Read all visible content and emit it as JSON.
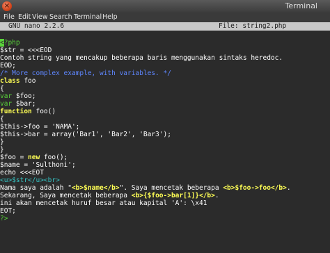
{
  "window": {
    "title": "Terminal",
    "close_glyph": "×"
  },
  "menu": [
    "File",
    "Edit",
    "View",
    "Search",
    "Terminal",
    "Help"
  ],
  "nano": {
    "version": "GNU nano 2.2.6",
    "file": "File: string2.php"
  },
  "code": {
    "l1_open": "<",
    "l1_rest": "?php",
    "l2": "$str = <<<EOD",
    "l3": "Contoh string yang mencakup beberapa baris menggunakan sintaks heredoc.",
    "l4": "EOD;",
    "l5": "/* More complex example, with variables. */",
    "l6_kw": "class",
    "l6_name": " foo",
    "l7": "{",
    "l8_kw": "var",
    "l8_rest": " $foo;",
    "l9_kw": "var",
    "l9_rest": " $bar;",
    "l10_kw": "function",
    "l10_rest": " foo()",
    "l11": "{",
    "l12": "$this->foo = 'NAMA';",
    "l13": "$this->bar = array('Bar1', 'Bar2', 'Bar3');",
    "l14": "}",
    "l15": "}",
    "l16_a": "$foo = ",
    "l16_kw": "new",
    "l16_b": " foo();",
    "l17": "$name = 'Sulthoni';",
    "l18": "echo <<<EOT",
    "l19": "<u>$str</u><br>",
    "l20_a": "Nama saya adalah \"",
    "l20_b": "<b>$name</b>",
    "l20_c": "\". Saya mencetak beberapa ",
    "l20_d": "<b>$foo->foo</b>",
    "l20_e": ".",
    "l21_a": "Sekarang, Saya mencetak beberapa ",
    "l21_b": "<b>{$foo->bar[1]}</b>",
    "l21_c": ".",
    "l22": "ini akan mencetak huruf besar atau kapital 'A': \\x41",
    "l23": "EOT;",
    "l24": "?>"
  },
  "colors": {
    "green": "#59d33a",
    "yellow": "#ffff55",
    "blue": "#5f87ff",
    "cyan": "#35c6c6"
  }
}
